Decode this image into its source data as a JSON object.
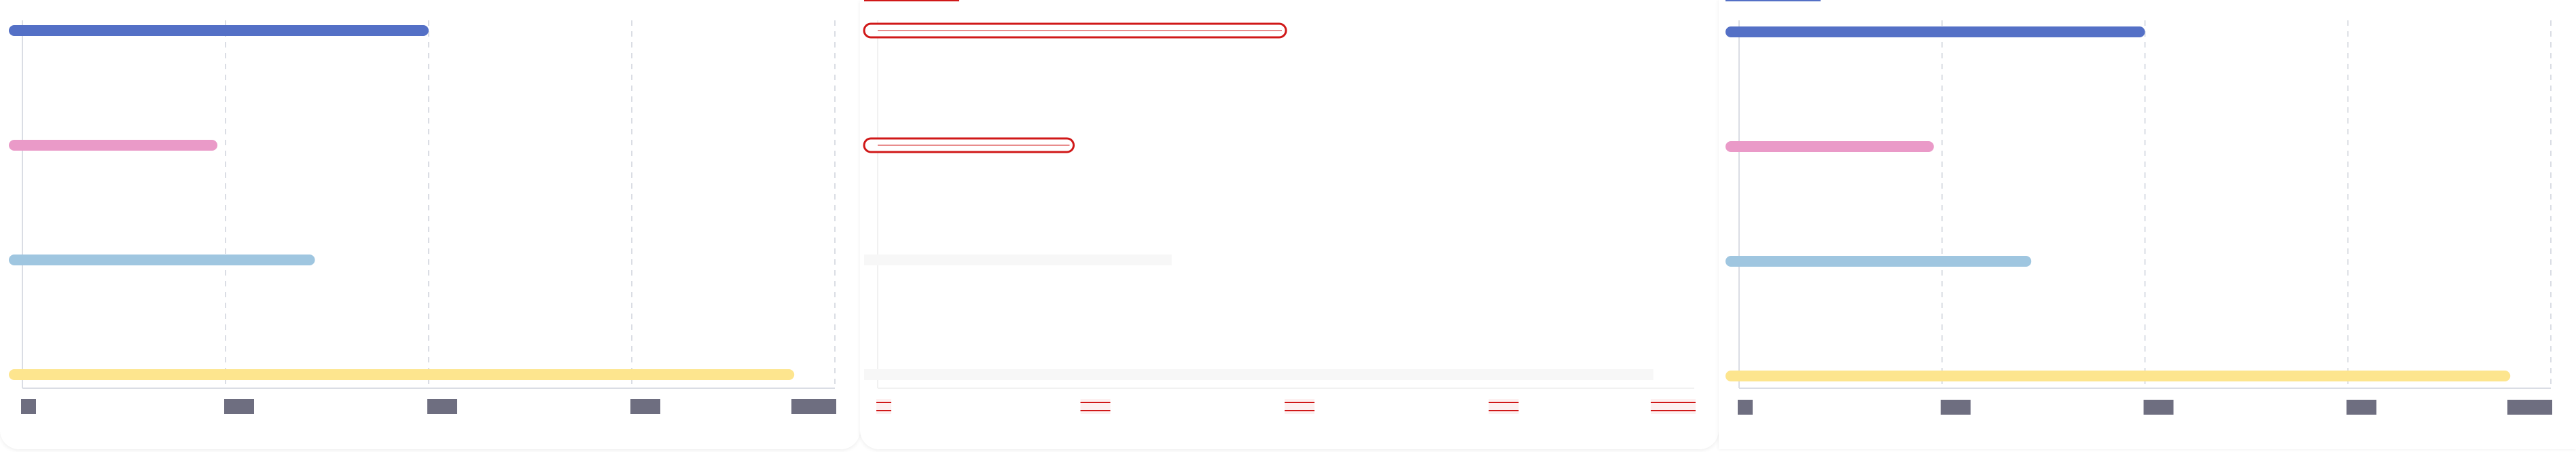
{
  "colors": {
    "grid": "#dadde4",
    "tick_block": "#6e6e80",
    "series": [
      "#5470c6",
      "#ea9ac8",
      "#9fc6e0",
      "#fde58e"
    ],
    "glitch_red": "#d01818"
  },
  "chart_data": [
    {
      "type": "bar",
      "orientation": "horizontal",
      "categories": [
        "",
        "",
        "",
        ""
      ],
      "values": [
        50,
        24,
        36,
        95
      ],
      "xlim": [
        0,
        100
      ],
      "x_ticks": [
        0,
        25,
        50,
        75,
        100
      ],
      "grid": true,
      "tick_labels_redacted": true
    },
    {
      "type": "bar",
      "orientation": "horizontal",
      "render_state": "glitched",
      "categories": [
        "",
        "",
        "",
        ""
      ],
      "values": [
        50,
        24,
        36,
        95
      ],
      "xlim": [
        0,
        100
      ],
      "x_ticks": [
        0,
        25,
        50,
        75,
        100
      ],
      "grid": false,
      "tick_labels_redacted": true
    },
    {
      "type": "bar",
      "orientation": "horizontal",
      "categories": [
        "",
        "",
        "",
        ""
      ],
      "values": [
        50,
        24,
        36,
        95
      ],
      "xlim": [
        0,
        100
      ],
      "x_ticks": [
        0,
        25,
        50,
        75,
        100
      ],
      "grid": true,
      "tick_labels_redacted": true
    }
  ]
}
